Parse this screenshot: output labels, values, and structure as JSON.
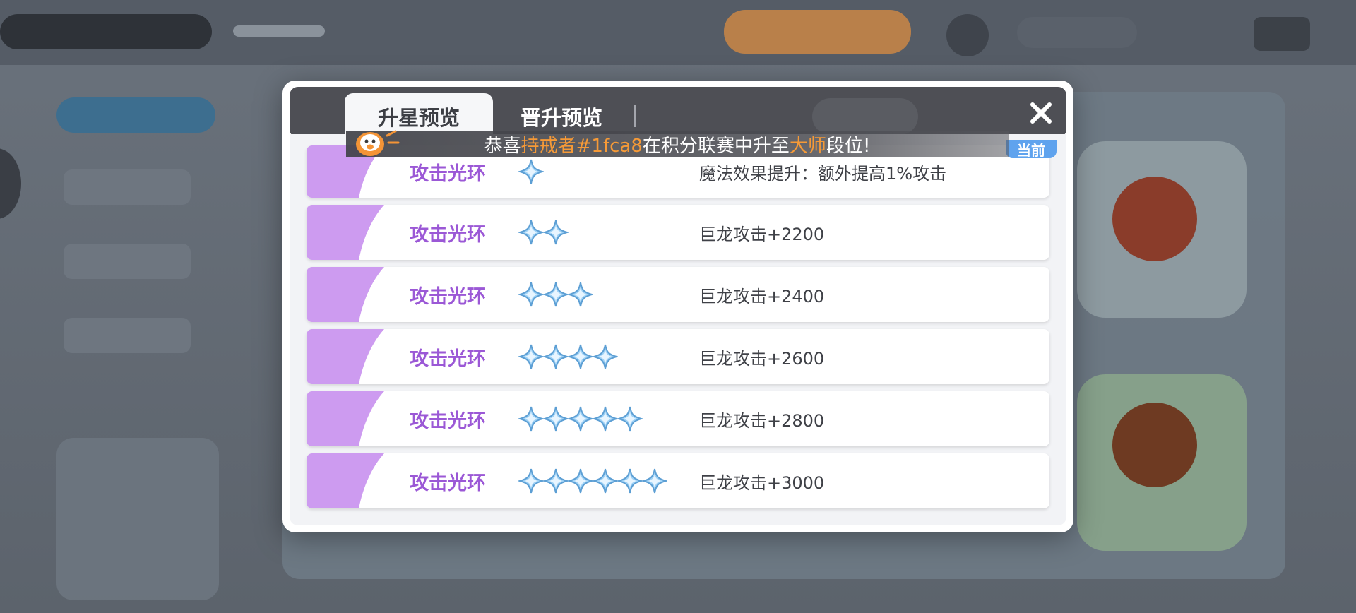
{
  "colors": {
    "accent_purple": "#9b58d6",
    "accent_lavender": "#cd9bf0",
    "header_dark": "#4e4f55",
    "highlight_orange": "#f69a37",
    "badge_blue": "#5fa3ee",
    "star_blue": "#9fd2f6"
  },
  "modal": {
    "tabs": [
      {
        "label": "升星预览",
        "active": true
      },
      {
        "label": "晋升预览",
        "active": false
      }
    ],
    "close_icon": "close-icon",
    "current_badge": "当前"
  },
  "banner": {
    "prefix": "恭喜",
    "player": "持戒者#1fca8",
    "middle": "在积分联赛中升至",
    "rank": "大师",
    "suffix": "段位!",
    "icon": "mascot-icon"
  },
  "rows": [
    {
      "name": "攻击光环",
      "stars": 1,
      "effect": "魔法效果提升：额外提高1%攻击",
      "current": true
    },
    {
      "name": "攻击光环",
      "stars": 2,
      "effect": "巨龙攻击+2200",
      "current": false
    },
    {
      "name": "攻击光环",
      "stars": 3,
      "effect": "巨龙攻击+2400",
      "current": false
    },
    {
      "name": "攻击光环",
      "stars": 4,
      "effect": "巨龙攻击+2600",
      "current": false
    },
    {
      "name": "攻击光环",
      "stars": 5,
      "effect": "巨龙攻击+2800",
      "current": false
    },
    {
      "name": "攻击光环",
      "stars": 6,
      "effect": "巨龙攻击+3000",
      "current": false
    }
  ]
}
